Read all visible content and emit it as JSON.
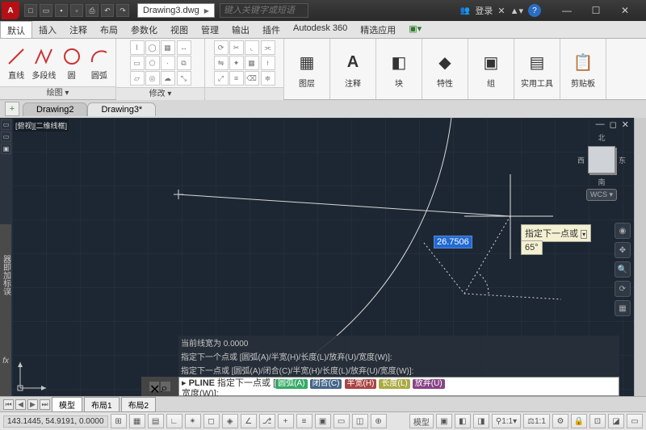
{
  "title": {
    "app_icon": "A",
    "filename": "Drawing3.dwg",
    "search_placeholder": "键入关键字或短语",
    "login": "登录",
    "x_icon": "✕"
  },
  "menu": {
    "tabs": [
      "默认",
      "插入",
      "注释",
      "布局",
      "参数化",
      "视图",
      "管理",
      "输出",
      "插件",
      "Autodesk 360",
      "精选应用"
    ],
    "active": 0
  },
  "ribbon": {
    "draw_panel": "绘图",
    "modify_panel": "修改",
    "draw_btns": [
      {
        "label": "直线"
      },
      {
        "label": "多段线"
      },
      {
        "label": "圆"
      },
      {
        "label": "圆弧"
      }
    ],
    "simple": [
      {
        "label": "图层",
        "glyph": "▦"
      },
      {
        "label": "注释",
        "glyph": "A"
      },
      {
        "label": "块",
        "glyph": "◧"
      },
      {
        "label": "特性",
        "glyph": "◆"
      },
      {
        "label": "组",
        "glyph": "▣"
      },
      {
        "label": "实用工具",
        "glyph": "▤"
      },
      {
        "label": "剪贴板",
        "glyph": "📋"
      }
    ]
  },
  "doc_tabs": {
    "tabs": [
      "Drawing2",
      "Drawing3*"
    ],
    "active": 1
  },
  "view": {
    "label": "[俯视][二维线框]",
    "compass": {
      "n": "北",
      "s": "南",
      "e": "东",
      "w": "西"
    },
    "wcs": "WCS"
  },
  "dynamic": {
    "length": "26.7506",
    "tooltip": "指定下一点或",
    "angle": "65°"
  },
  "cmd": {
    "log": [
      "当前线宽为  0.0000",
      "指定下一个点或 [圆弧(A)/半宽(H)/长度(L)/放弃(U)/宽度(W)]:",
      "指定下一点或 [圆弧(A)/闭合(C)/半宽(H)/长度(L)/放弃(U)/宽度(W)]:"
    ],
    "prompt_cmd": "PLINE",
    "prompt_text": "指定下一点或",
    "kw": {
      "a": "圆弧(A)",
      "c": "闭合(C)",
      "h": "半宽(H)",
      "l": "长度(L)",
      "u": "放弃(U)"
    },
    "prompt_line2": "宽度(W)]:"
  },
  "model_tabs": {
    "tabs": [
      "模型",
      "布局1",
      "布局2"
    ],
    "active": 0
  },
  "status": {
    "coords": "143.1445, 54.9191, 0.0000",
    "model": "模型",
    "scale": "1:1",
    "anno": "1:1"
  }
}
